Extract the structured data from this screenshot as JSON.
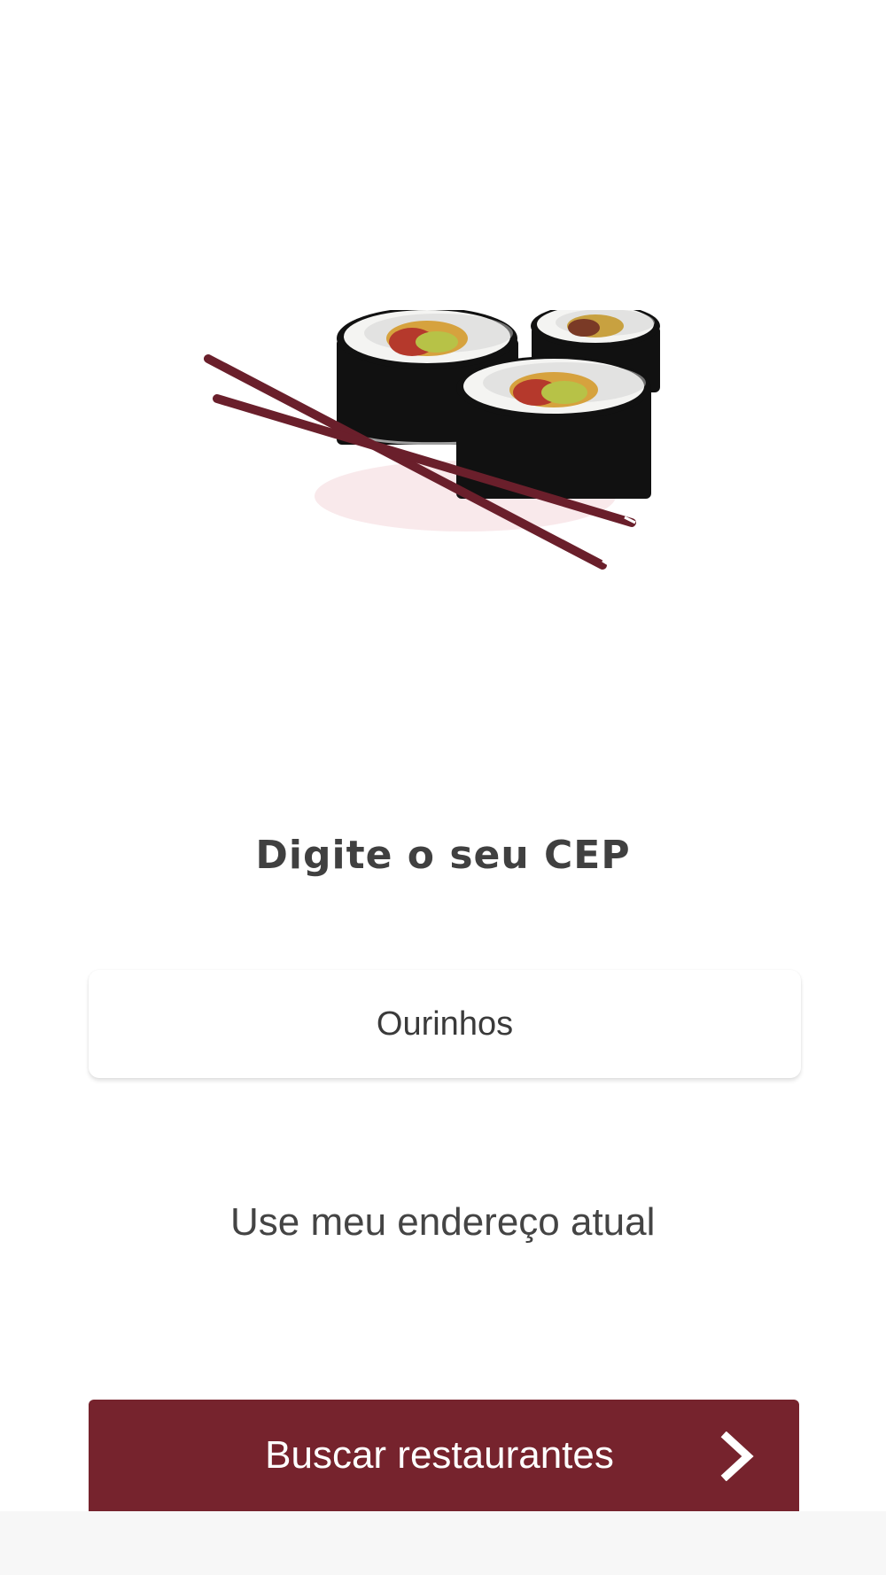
{
  "header": {
    "title": "Digite o seu CEP"
  },
  "cep_field": {
    "value": "Ourinhos",
    "placeholder": ""
  },
  "location_link": {
    "label": "Use meu endereço atual"
  },
  "search_button": {
    "label": "Buscar restaurantes",
    "icon": "chevron-right-icon"
  },
  "hero": {
    "icon": "sushi-chopsticks-illustration"
  },
  "colors": {
    "brand": "#76232d",
    "text": "#404040",
    "background": "#ffffff"
  }
}
